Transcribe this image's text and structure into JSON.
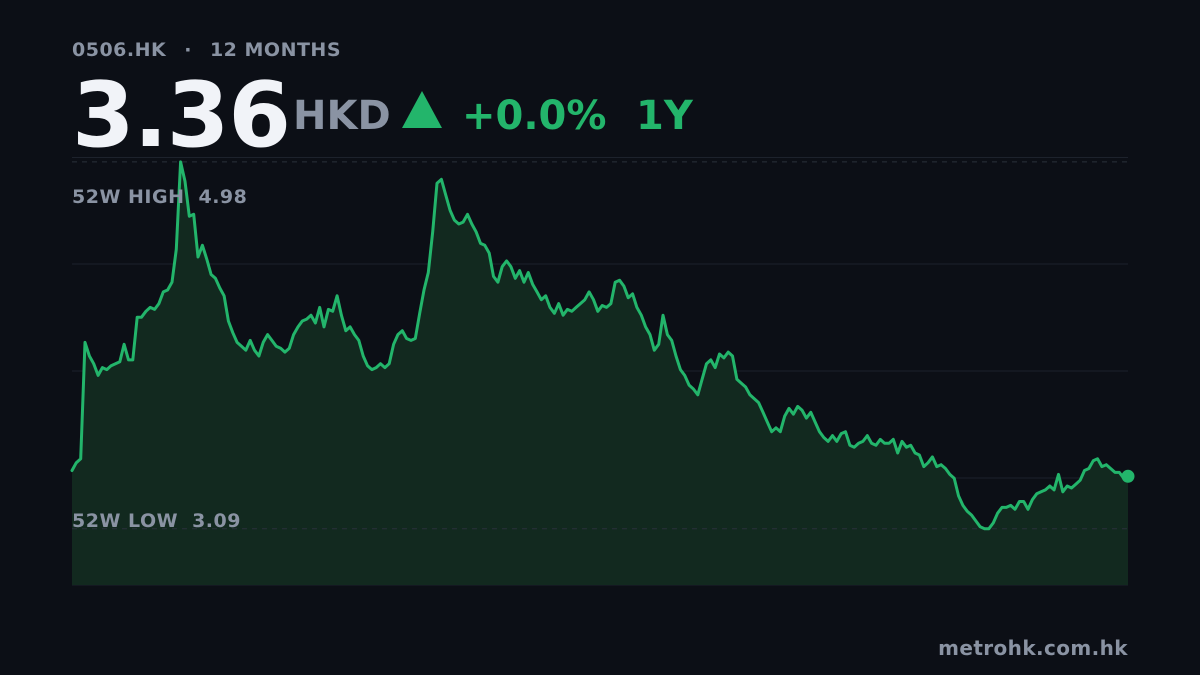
{
  "header": {
    "ticker": "0506.HK",
    "separator": "·",
    "range_label": "12 MONTHS",
    "price": "3.36",
    "currency": "HKD",
    "change": "+0.0%",
    "period": "1Y"
  },
  "high_label": {
    "text": "52W HIGH",
    "value": "4.98"
  },
  "low_label": {
    "text": "52W LOW",
    "value": "3.09"
  },
  "source": "metrohk.com.hk",
  "colors": {
    "background": "#0c0f16",
    "line": "#23b56b",
    "fill": "#12291f",
    "grid": "#1d222c",
    "muted_text": "#8a93a3"
  },
  "chart_data": {
    "type": "area",
    "ylim": [
      2.8,
      5.0
    ],
    "reference_lines": {
      "high": 4.98,
      "low": 3.09
    },
    "values": [
      3.39,
      3.43,
      3.45,
      4.05,
      3.98,
      3.94,
      3.88,
      3.92,
      3.91,
      3.93,
      3.94,
      3.95,
      4.04,
      3.96,
      3.96,
      4.18,
      4.18,
      4.21,
      4.23,
      4.22,
      4.25,
      4.31,
      4.32,
      4.36,
      4.53,
      4.98,
      4.88,
      4.7,
      4.71,
      4.49,
      4.55,
      4.48,
      4.4,
      4.38,
      4.33,
      4.29,
      4.16,
      4.1,
      4.05,
      4.03,
      4.01,
      4.06,
      4.01,
      3.98,
      4.05,
      4.09,
      4.06,
      4.03,
      4.02,
      4.0,
      4.02,
      4.09,
      4.13,
      4.16,
      4.17,
      4.19,
      4.15,
      4.23,
      4.13,
      4.22,
      4.21,
      4.29,
      4.19,
      4.11,
      4.13,
      4.09,
      4.06,
      3.98,
      3.93,
      3.91,
      3.92,
      3.94,
      3.92,
      3.94,
      4.04,
      4.09,
      4.11,
      4.07,
      4.06,
      4.07,
      4.2,
      4.32,
      4.41,
      4.62,
      4.87,
      4.89,
      4.81,
      4.73,
      4.68,
      4.66,
      4.67,
      4.71,
      4.66,
      4.62,
      4.56,
      4.55,
      4.51,
      4.39,
      4.36,
      4.44,
      4.47,
      4.44,
      4.38,
      4.42,
      4.36,
      4.41,
      4.35,
      4.31,
      4.27,
      4.29,
      4.23,
      4.2,
      4.25,
      4.19,
      4.22,
      4.21,
      4.23,
      4.25,
      4.27,
      4.31,
      4.27,
      4.21,
      4.24,
      4.23,
      4.25,
      4.36,
      4.37,
      4.34,
      4.28,
      4.3,
      4.23,
      4.19,
      4.13,
      4.09,
      4.01,
      4.04,
      4.19,
      4.09,
      4.06,
      3.98,
      3.91,
      3.88,
      3.83,
      3.81,
      3.78,
      3.86,
      3.94,
      3.96,
      3.92,
      3.99,
      3.97,
      4.0,
      3.98,
      3.86,
      3.84,
      3.82,
      3.78,
      3.76,
      3.74,
      3.69,
      3.64,
      3.59,
      3.61,
      3.59,
      3.67,
      3.71,
      3.68,
      3.72,
      3.7,
      3.66,
      3.69,
      3.64,
      3.59,
      3.56,
      3.54,
      3.57,
      3.54,
      3.58,
      3.59,
      3.52,
      3.51,
      3.53,
      3.54,
      3.57,
      3.53,
      3.52,
      3.55,
      3.53,
      3.53,
      3.55,
      3.48,
      3.54,
      3.51,
      3.52,
      3.48,
      3.47,
      3.41,
      3.43,
      3.46,
      3.41,
      3.42,
      3.4,
      3.37,
      3.35,
      3.26,
      3.21,
      3.18,
      3.16,
      3.13,
      3.1,
      3.09,
      3.09,
      3.12,
      3.17,
      3.2,
      3.2,
      3.21,
      3.19,
      3.23,
      3.23,
      3.19,
      3.24,
      3.27,
      3.28,
      3.29,
      3.31,
      3.29,
      3.37,
      3.28,
      3.31,
      3.3,
      3.32,
      3.34,
      3.39,
      3.4,
      3.44,
      3.45,
      3.41,
      3.42,
      3.4,
      3.38,
      3.38,
      3.35,
      3.36
    ]
  }
}
